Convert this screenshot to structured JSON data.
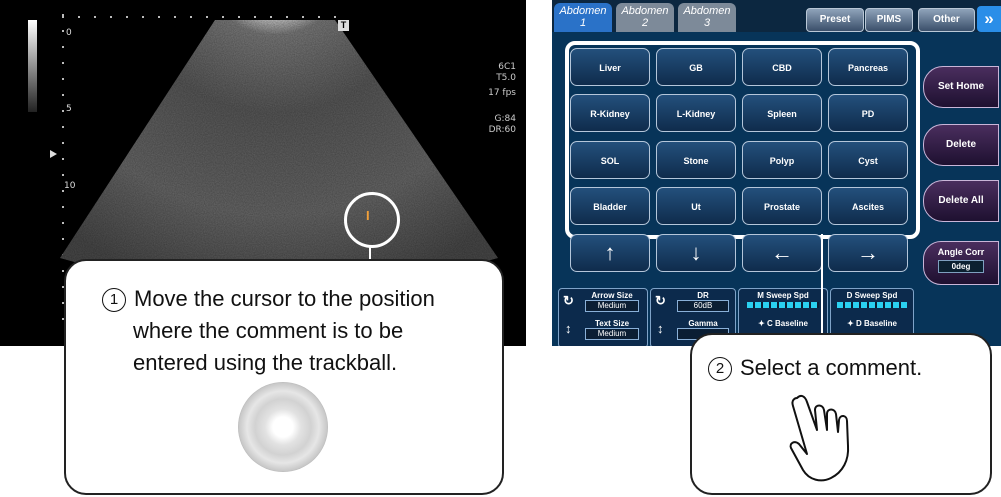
{
  "ultrasound": {
    "depth_marks": [
      "0",
      "5",
      "10"
    ],
    "probe": "6C1",
    "preset_code": "T5.0",
    "frame_rate": "17 fps",
    "gain": "G:84",
    "dynamic_range": "DR:60",
    "marker_icon": "T",
    "cursor_symbol": "I"
  },
  "callout1": {
    "number": "1",
    "lines": [
      "Move the cursor to the position",
      "where the comment is to be",
      "entered using the trackball."
    ]
  },
  "touch_panel": {
    "tabs": [
      {
        "line1": "Abdomen",
        "line2": "1"
      },
      {
        "line1": "Abdomen",
        "line2": "2"
      },
      {
        "line1": "Abdomen",
        "line2": "3"
      }
    ],
    "top_buttons": [
      "Preset",
      "PIMS",
      "Other"
    ],
    "next_icon": "»",
    "comments": [
      [
        "Liver",
        "GB",
        "CBD",
        "Pancreas"
      ],
      [
        "R-Kidney",
        "L-Kidney",
        "Spleen",
        "PD"
      ],
      [
        "SOL",
        "Stone",
        "Polyp",
        "Cyst"
      ],
      [
        "Bladder",
        "Ut",
        "Prostate",
        "Ascites"
      ]
    ],
    "arrows": [
      "↑",
      "↓",
      "←",
      "→"
    ],
    "side_buttons": [
      "Set Home",
      "Delete",
      "Delete All"
    ],
    "angle_corr": {
      "label": "Angle Corr",
      "value": "0deg"
    },
    "knobs": {
      "arrow_size": {
        "label": "Arrow Size",
        "value": "Medium"
      },
      "text_size": {
        "label": "Text Size",
        "value": "Medium"
      },
      "dr": {
        "label": "DR",
        "value": "60dB"
      },
      "gamma": {
        "label": "Gamma"
      },
      "m_sweep": {
        "label": "M Sweep Spd"
      },
      "c_baseline": {
        "label": "C Baseline"
      },
      "d_sweep": {
        "label": "D Sweep Spd"
      },
      "d_baseline": {
        "label": "D Baseline"
      }
    }
  },
  "callout2": {
    "number": "2",
    "text": "Select a comment."
  }
}
